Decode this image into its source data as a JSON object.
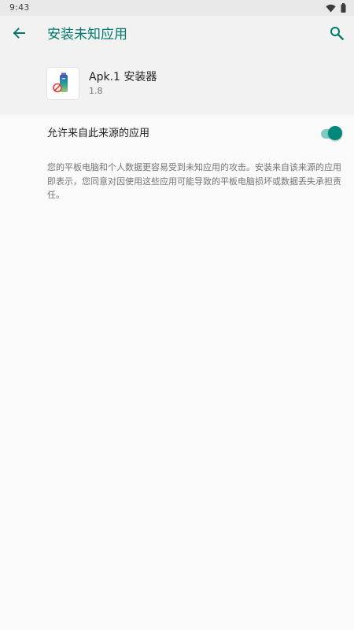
{
  "status_bar": {
    "time": "9:43",
    "icons": [
      "wifi-icon",
      "battery-icon"
    ]
  },
  "app_bar": {
    "title": "安装未知应用",
    "back_icon": "arrow-back-icon",
    "search_icon": "search-icon"
  },
  "app_info": {
    "name": "Apk.1 安装器",
    "version": "1.8"
  },
  "setting": {
    "label": "允许来自此来源的应用",
    "enabled": true
  },
  "warning": {
    "text": "您的平板电脑和个人数据更容易受到未知应用的攻击。安装来自该来源的应用即表示，您同意对因使用这些应用可能导致的平板电脑损坏或数据丢失承担责任。"
  },
  "colors": {
    "accent": "#00796b",
    "toggle_thumb": "#00897b",
    "toggle_track": "#80cbc4",
    "background": "#fafafa",
    "header_background": "#f2f2f2"
  }
}
